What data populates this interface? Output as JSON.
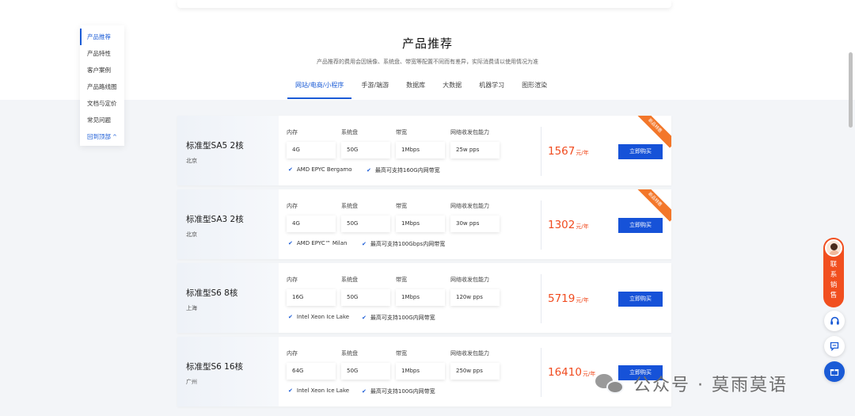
{
  "sidenav": {
    "items": [
      "产品推荐",
      "产品特性",
      "客户案例",
      "产品路线图",
      "文档与定价",
      "常见问题"
    ],
    "back_to_top": "回到顶部",
    "back_caret": "^"
  },
  "header": {
    "title": "产品推荐",
    "subtitle": "产品推荐的费用会因镜像、系统盘、带宽等配置不同而有差异，实际消费请以使用情况为准"
  },
  "tabs": [
    "网站/电商/小程序",
    "手游/端游",
    "数据库",
    "大数据",
    "机器学习",
    "图形渲染"
  ],
  "spec_labels": [
    "内存",
    "系统盘",
    "带宽",
    "网络收发包能力"
  ],
  "buy_label": "立即购买",
  "price_unit": "元/年",
  "ribbon_label": "新品特惠",
  "products": [
    {
      "name": "标准型SA5 2核",
      "region": "北京",
      "specs": [
        "4G",
        "50G",
        "1Mbps",
        "25w pps"
      ],
      "features": [
        "AMD EPYC Bergamo",
        "最高可支持160G内网带宽"
      ],
      "price": "1567",
      "ribbon": true
    },
    {
      "name": "标准型SA3 2核",
      "region": "北京",
      "specs": [
        "4G",
        "50G",
        "1Mbps",
        "30w pps"
      ],
      "features": [
        "AMD EPYC™ Milan",
        "最高可支持100Gbps内网带宽"
      ],
      "price": "1302",
      "ribbon": true
    },
    {
      "name": "标准型S6 8核",
      "region": "上海",
      "specs": [
        "16G",
        "50G",
        "1Mbps",
        "120w pps"
      ],
      "features": [
        "Intel Xeon Ice Lake",
        "最高可支持100G内网带宽"
      ],
      "price": "5719",
      "ribbon": false
    },
    {
      "name": "标准型S6 16核",
      "region": "广州",
      "specs": [
        "64G",
        "50G",
        "1Mbps",
        "250w pps"
      ],
      "features": [
        "Intel Xeon Ice Lake",
        "最高可支持100G内网带宽"
      ],
      "price": "16410",
      "ribbon": false
    }
  ],
  "contact": {
    "label": "联系销售"
  },
  "float_icons": [
    "headset-icon",
    "message-icon",
    "gift-icon"
  ],
  "watermark": {
    "text": "公众号 · 莫雨莫语"
  },
  "colors": {
    "accent": "#1a5bd6",
    "price": "#f04b1f",
    "ribbon": "#f3772a"
  }
}
